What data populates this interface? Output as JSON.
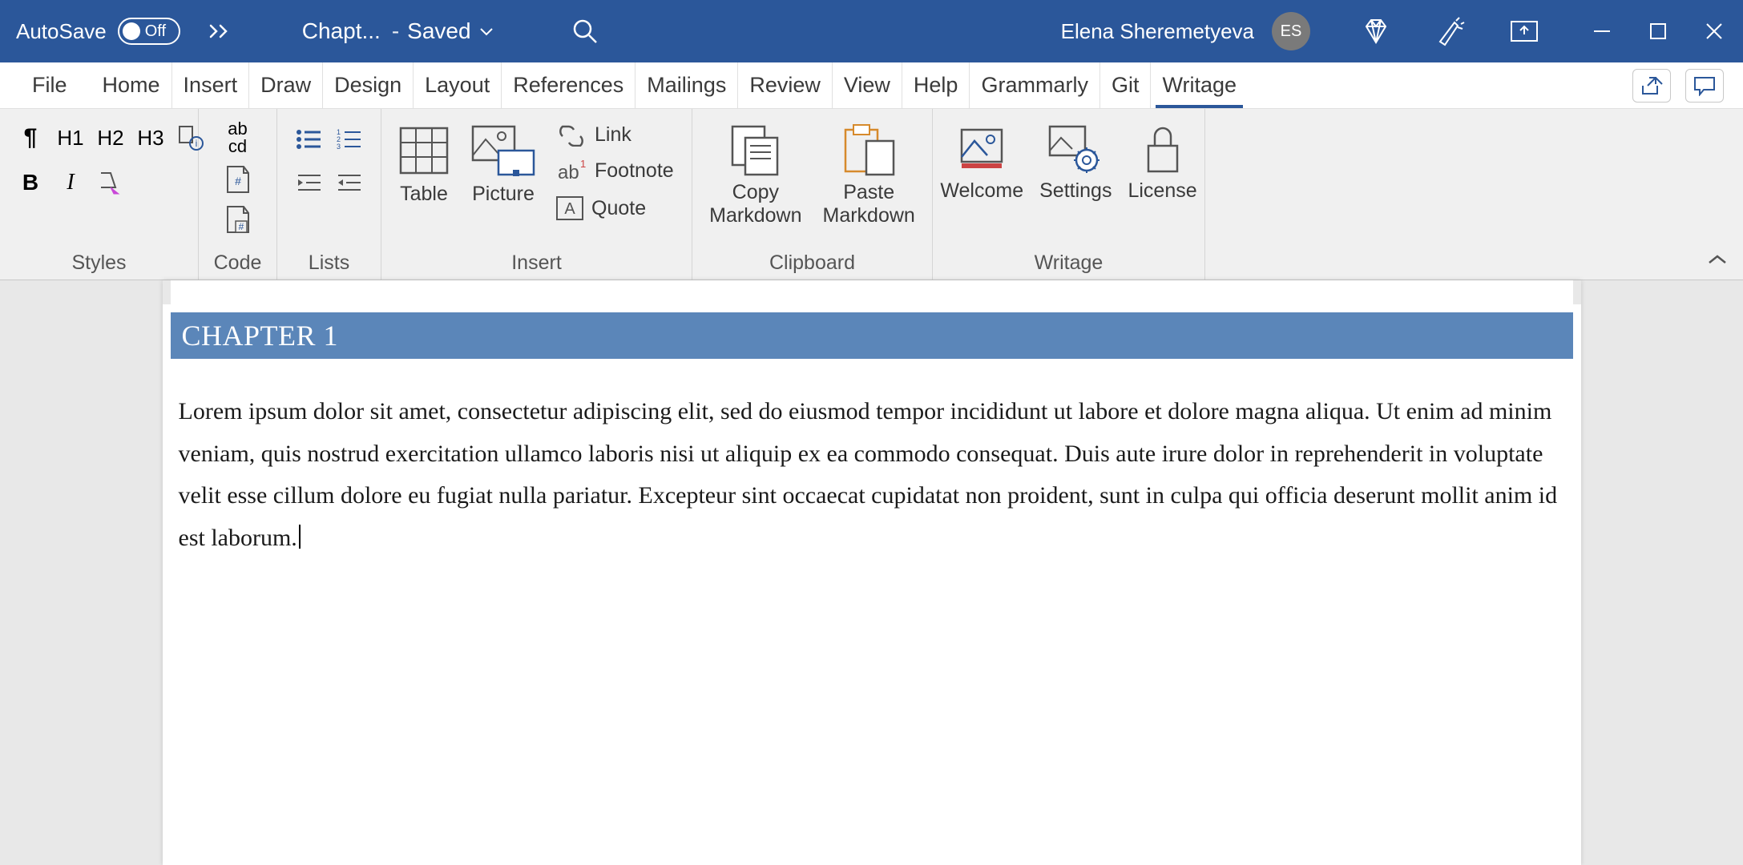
{
  "titlebar": {
    "autosave_label": "AutoSave",
    "autosave_state": "Off",
    "doc_name": "Chapt...",
    "saved_label": "Saved",
    "user_name": "Elena Sheremetyeva",
    "user_initials": "ES"
  },
  "tabs": {
    "file": "File",
    "home": "Home",
    "insert": "Insert",
    "draw": "Draw",
    "design": "Design",
    "layout": "Layout",
    "references": "References",
    "mailings": "Mailings",
    "review": "Review",
    "view": "View",
    "help": "Help",
    "grammarly": "Grammarly",
    "git": "Git",
    "writage": "Writage"
  },
  "ribbon": {
    "styles": {
      "group_label": "Styles",
      "h1": "H1",
      "h2": "H2",
      "h3": "H3",
      "b": "B",
      "i": "I"
    },
    "code": {
      "group_label": "Code",
      "inline": "ab\ncd"
    },
    "lists": {
      "group_label": "Lists"
    },
    "insert": {
      "group_label": "Insert",
      "table": "Table",
      "picture": "Picture",
      "link": "Link",
      "footnote": "Footnote",
      "quote": "Quote"
    },
    "clipboard": {
      "group_label": "Clipboard",
      "copy": "Copy Markdown",
      "paste": "Paste Markdown"
    },
    "writage": {
      "group_label": "Writage",
      "welcome": "Welcome",
      "settings": "Settings",
      "license": "License"
    }
  },
  "document": {
    "heading": "CHAPTER 1",
    "body": "Lorem ipsum dolor sit amet, consectetur adipiscing elit, sed do eiusmod tempor incididunt ut labore et dolore magna aliqua. Ut enim ad minim veniam, quis nostrud exercitation ullamco laboris nisi ut aliquip ex ea commodo consequat. Duis aute irure dolor in reprehenderit in voluptate velit esse cillum dolore eu fugiat nulla pariatur. Excepteur sint occaecat cupidatat non proident, sunt in culpa qui officia deserunt mollit anim id est laborum."
  }
}
